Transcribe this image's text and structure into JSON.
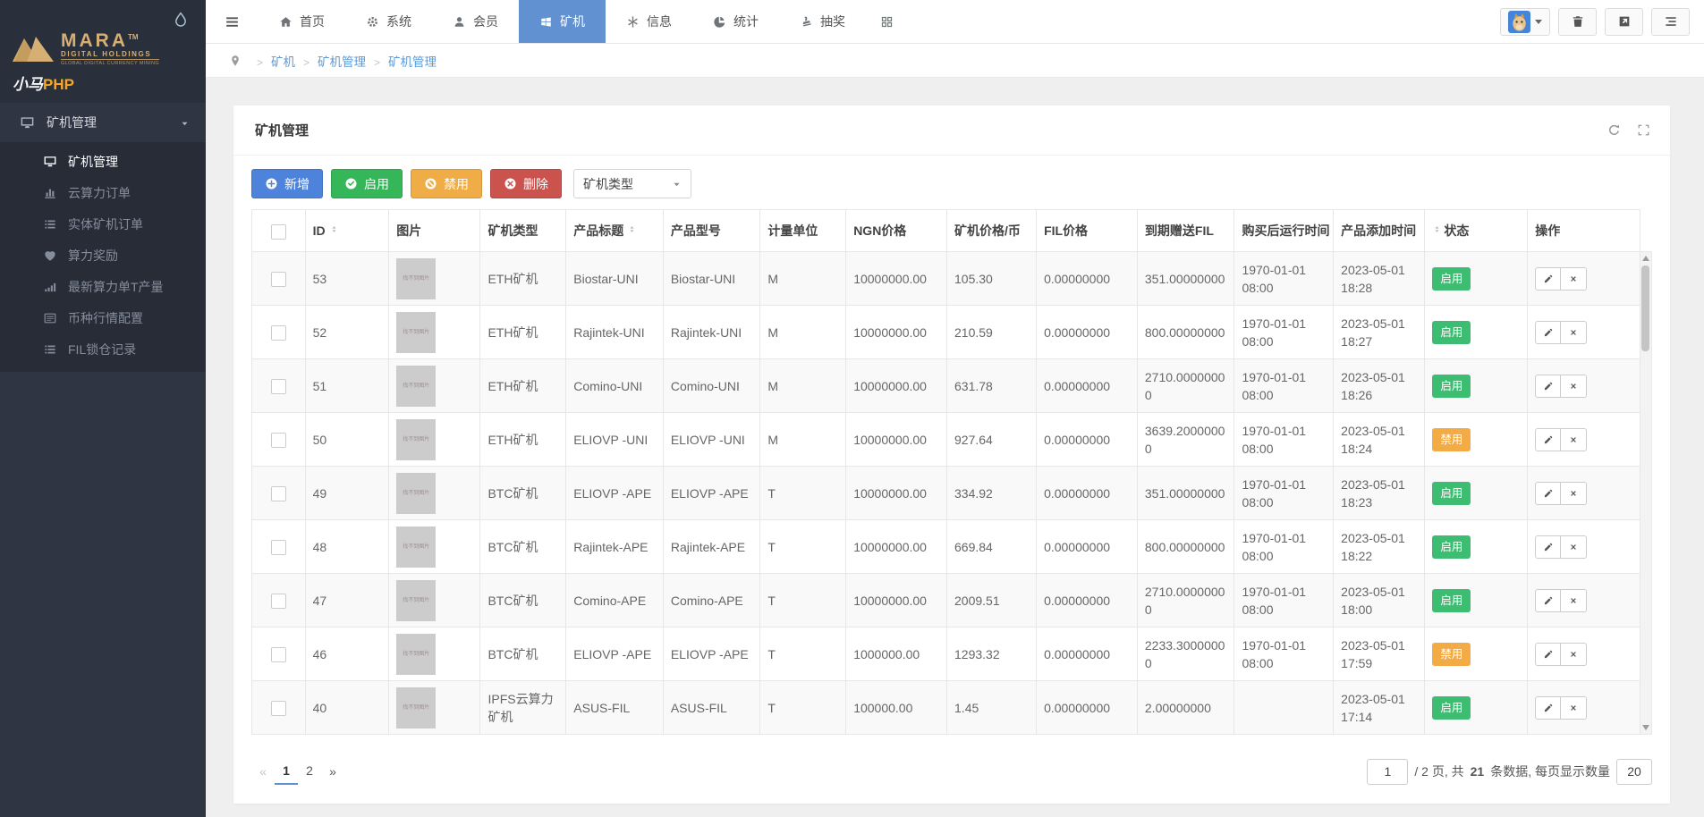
{
  "brand": {
    "logo_text": "MARA",
    "logo_tm": "TM",
    "logo_sub": "DIGITAL HOLDINGS",
    "logo_tagline": "GLOBAL DIGITAL CURRENCY MINING",
    "app_name": "小马",
    "app_suffix": "PHP",
    "gold": "#d6af74",
    "orange": "#f7a723"
  },
  "topnav": {
    "active_color": "#6291d2",
    "items": [
      {
        "label": "首页",
        "icon": "home-icon",
        "active": false
      },
      {
        "label": "系统",
        "icon": "gear-icon",
        "active": false
      },
      {
        "label": "会员",
        "icon": "user-icon",
        "active": false
      },
      {
        "label": "矿机",
        "icon": "windows-icon",
        "active": true
      },
      {
        "label": "信息",
        "icon": "asterisk-icon",
        "active": false
      },
      {
        "label": "统计",
        "icon": "pie-chart-icon",
        "active": false
      },
      {
        "label": "抽奖",
        "icon": "stamp-icon",
        "active": false
      },
      {
        "label": "",
        "icon": "grid-icon",
        "active": false
      }
    ]
  },
  "sidebar": {
    "parent": {
      "label": "矿机管理",
      "icon": "desktop-icon"
    },
    "items": [
      {
        "label": "矿机管理",
        "icon": "monitor-icon",
        "active": true
      },
      {
        "label": "云算力订单",
        "icon": "bar-chart-icon",
        "active": false
      },
      {
        "label": "实体矿机订单",
        "icon": "list-icon",
        "active": false
      },
      {
        "label": "算力奖励",
        "icon": "heart-icon",
        "active": false
      },
      {
        "label": "最新算力单T产量",
        "icon": "signal-icon",
        "active": false
      },
      {
        "label": "币种行情配置",
        "icon": "news-icon",
        "active": false
      },
      {
        "label": "FIL锁仓记录",
        "icon": "list-icon",
        "active": false
      }
    ]
  },
  "breadcrumb": {
    "items": [
      "矿机",
      "矿机管理",
      "矿机管理"
    ]
  },
  "panel": {
    "title": "矿机管理"
  },
  "toolbar": {
    "buttons": [
      {
        "name": "add",
        "label": "新增",
        "icon": "plus-circle-icon",
        "color": "#4d83da"
      },
      {
        "name": "enable",
        "label": "启用",
        "icon": "check-circle-icon",
        "color": "#35b759"
      },
      {
        "name": "disable",
        "label": "禁用",
        "icon": "ban-circle-icon",
        "color": "#f0ac47"
      },
      {
        "name": "delete",
        "label": "删除",
        "icon": "x-circle-icon",
        "color": "#ca534e"
      }
    ],
    "type_select": "矿机类型"
  },
  "table": {
    "image_placeholder": "找不到图片",
    "status_colors": {
      "启用": "#3dbd72",
      "禁用": "#f3ab45"
    },
    "headers": [
      {
        "type": "checkbox",
        "label": ""
      },
      {
        "label": "ID",
        "sort": "after"
      },
      {
        "label": "图片"
      },
      {
        "label": "矿机类型"
      },
      {
        "label": "产品标题",
        "sort": "after"
      },
      {
        "label": "产品型号"
      },
      {
        "label": "计量单位"
      },
      {
        "label": "NGN价格"
      },
      {
        "label": "矿机价格/币"
      },
      {
        "label": "FIL价格"
      },
      {
        "label": "到期赠送FIL"
      },
      {
        "label": "购买后运行时间"
      },
      {
        "label": "产品添加时间"
      },
      {
        "label": "状态",
        "sort": "before"
      },
      {
        "label": "操作"
      }
    ],
    "rows": [
      {
        "id": "53",
        "type": "ETH矿机",
        "title": "Biostar-UNI",
        "model": "Biostar-UNI",
        "unit": "M",
        "ngn_price": "10000000.00",
        "machine_price": "105.30",
        "fil_price": "0.00000000",
        "expire_gift_fil": "351.00000000",
        "runtime": "1970-01-01 08:00",
        "added": "2023-05-01 18:28",
        "status": "启用"
      },
      {
        "id": "52",
        "type": "ETH矿机",
        "title": "Rajintek-UNI",
        "model": "Rajintek-UNI",
        "unit": "M",
        "ngn_price": "10000000.00",
        "machine_price": "210.59",
        "fil_price": "0.00000000",
        "expire_gift_fil": "800.00000000",
        "runtime": "1970-01-01 08:00",
        "added": "2023-05-01 18:27",
        "status": "启用"
      },
      {
        "id": "51",
        "type": "ETH矿机",
        "title": "Comino-UNI",
        "model": "Comino-UNI",
        "unit": "M",
        "ngn_price": "10000000.00",
        "machine_price": "631.78",
        "fil_price": "0.00000000",
        "expire_gift_fil": "2710.00000000",
        "runtime": "1970-01-01 08:00",
        "added": "2023-05-01 18:26",
        "status": "启用"
      },
      {
        "id": "50",
        "type": "ETH矿机",
        "title": "ELIOVP -UNI",
        "model": "ELIOVP -UNI",
        "unit": "M",
        "ngn_price": "10000000.00",
        "machine_price": "927.64",
        "fil_price": "0.00000000",
        "expire_gift_fil": "3639.20000000",
        "runtime": "1970-01-01 08:00",
        "added": "2023-05-01 18:24",
        "status": "禁用"
      },
      {
        "id": "49",
        "type": "BTC矿机",
        "title": "ELIOVP -APE",
        "model": "ELIOVP -APE",
        "unit": "T",
        "ngn_price": "10000000.00",
        "machine_price": "334.92",
        "fil_price": "0.00000000",
        "expire_gift_fil": "351.00000000",
        "runtime": "1970-01-01 08:00",
        "added": "2023-05-01 18:23",
        "status": "启用"
      },
      {
        "id": "48",
        "type": "BTC矿机",
        "title": "Rajintek-APE",
        "model": "Rajintek-APE",
        "unit": "T",
        "ngn_price": "10000000.00",
        "machine_price": "669.84",
        "fil_price": "0.00000000",
        "expire_gift_fil": "800.00000000",
        "runtime": "1970-01-01 08:00",
        "added": "2023-05-01 18:22",
        "status": "启用"
      },
      {
        "id": "47",
        "type": "BTC矿机",
        "title": "Comino-APE",
        "model": "Comino-APE",
        "unit": "T",
        "ngn_price": "10000000.00",
        "machine_price": "2009.51",
        "fil_price": "0.00000000",
        "expire_gift_fil": "2710.00000000",
        "runtime": "1970-01-01 08:00",
        "added": "2023-05-01 18:00",
        "status": "启用"
      },
      {
        "id": "46",
        "type": "BTC矿机",
        "title": "ELIOVP -APE",
        "model": "ELIOVP -APE",
        "unit": "T",
        "ngn_price": "1000000.00",
        "machine_price": "1293.32",
        "fil_price": "0.00000000",
        "expire_gift_fil": "2233.30000000",
        "runtime": "1970-01-01 08:00",
        "added": "2023-05-01 17:59",
        "status": "禁用"
      },
      {
        "id": "40",
        "type": "IPFS云算力矿机",
        "title": "ASUS-FIL",
        "model": "ASUS-FIL",
        "unit": "T",
        "ngn_price": "100000.00",
        "machine_price": "1.45",
        "fil_price": "0.00000000",
        "expire_gift_fil": "2.00000000",
        "runtime": "",
        "added": "2023-05-01 17:14",
        "status": "启用"
      }
    ]
  },
  "pagination": {
    "prev": "«",
    "next": "»",
    "pages": [
      "1",
      "2"
    ],
    "active_page": "1",
    "jump_value": "1",
    "info_before": "/ 2 页, 共",
    "info_count": "21",
    "info_after": "条数据, 每页显示数量",
    "page_size": "20"
  }
}
